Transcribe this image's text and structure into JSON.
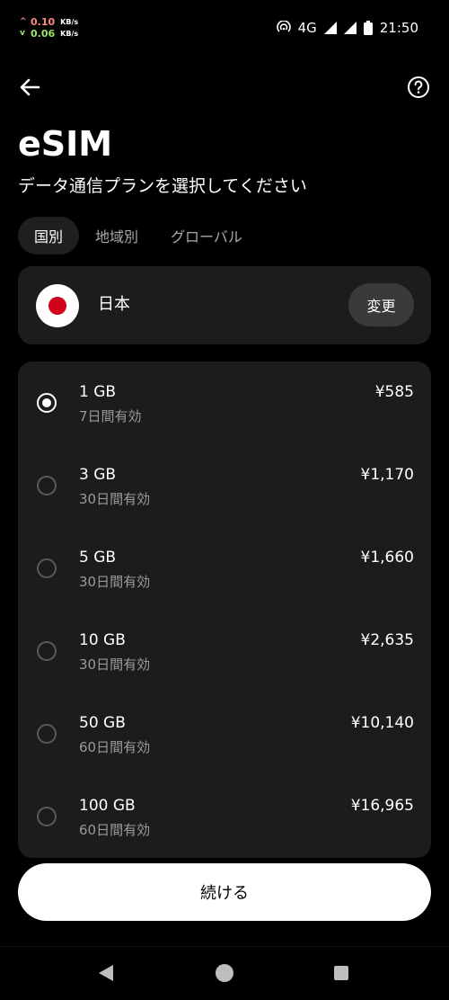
{
  "status_bar": {
    "upload_speed": "0.10",
    "download_speed": "0.06",
    "speed_unit": "KB/s",
    "network_type": "4G",
    "time": "21:50"
  },
  "header": {
    "title": "eSIM",
    "subtitle": "データ通信プランを選択してください"
  },
  "tabs": [
    {
      "label": "国別",
      "active": true
    },
    {
      "label": "地域別",
      "active": false
    },
    {
      "label": "グローバル",
      "active": false
    }
  ],
  "country": {
    "name": "日本",
    "change_label": "変更",
    "flag_colors": {
      "background": "#ffffff",
      "circle": "#d0021b"
    }
  },
  "plans": [
    {
      "size": "1 GB",
      "validity": "7日間有効",
      "price": "¥585",
      "selected": true
    },
    {
      "size": "3 GB",
      "validity": "30日間有効",
      "price": "¥1,170",
      "selected": false
    },
    {
      "size": "5 GB",
      "validity": "30日間有効",
      "price": "¥1,660",
      "selected": false
    },
    {
      "size": "10 GB",
      "validity": "30日間有効",
      "price": "¥2,635",
      "selected": false
    },
    {
      "size": "50 GB",
      "validity": "60日間有効",
      "price": "¥10,140",
      "selected": false
    },
    {
      "size": "100 GB",
      "validity": "60日間有効",
      "price": "¥16,965",
      "selected": false
    }
  ],
  "footer": {
    "continue_label": "続ける"
  },
  "icons": {
    "back": "arrow-left-icon",
    "help": "question-circle-icon"
  },
  "colors": {
    "background": "#000000",
    "card": "#1c1c1c",
    "button_primary": "#ffffff",
    "muted_text": "#9a9a9a"
  }
}
